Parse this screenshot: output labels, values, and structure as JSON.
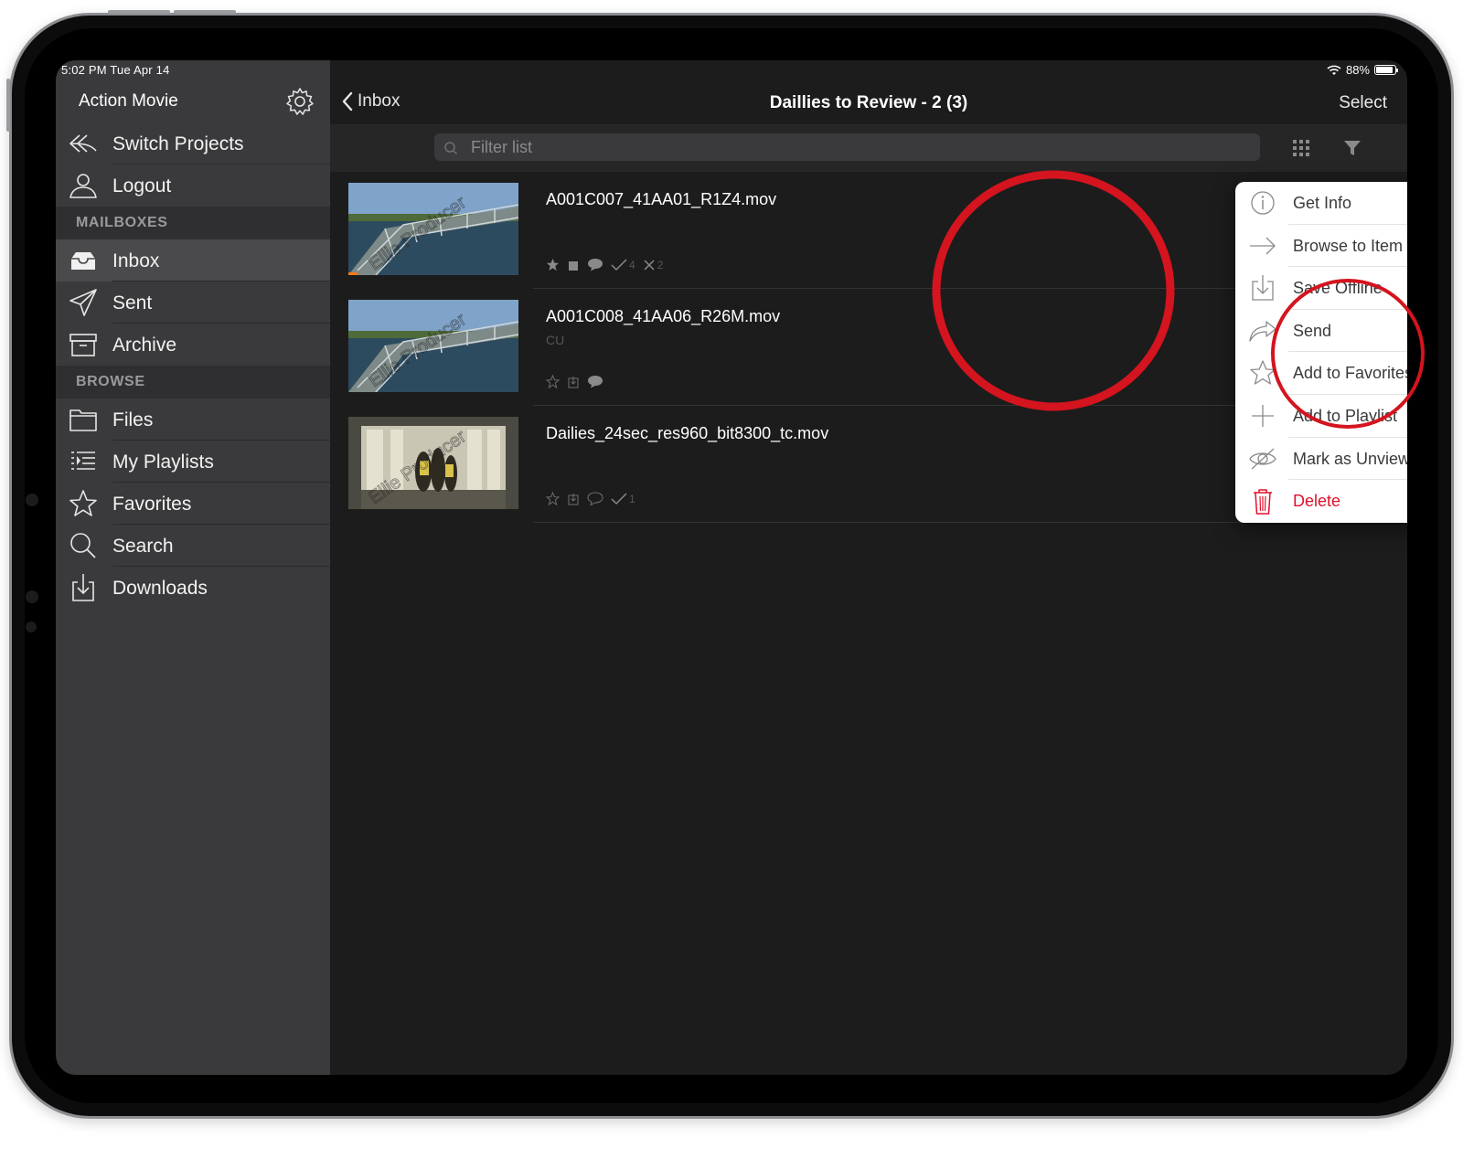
{
  "status_bar": {
    "time": "5:02 PM   Tue Apr 14",
    "battery": "88%",
    "battery_level": 0.88
  },
  "sidebar": {
    "project_title": "Action Movie",
    "items_top": [
      {
        "label": "Switch Projects",
        "icon": "switch-arrow-icon"
      },
      {
        "label": "Logout",
        "icon": "person-icon"
      }
    ],
    "mailboxes_header": "MAILBOXES",
    "mailboxes": [
      {
        "label": "Inbox",
        "icon": "inbox-icon",
        "active": true
      },
      {
        "label": "Sent",
        "icon": "paper-plane-icon"
      },
      {
        "label": "Archive",
        "icon": "archive-box-icon"
      }
    ],
    "browse_header": "BROWSE",
    "browse": [
      {
        "label": "Files",
        "icon": "folder-icon"
      },
      {
        "label": "My Playlists",
        "icon": "playlist-icon"
      },
      {
        "label": "Favorites",
        "icon": "star-icon"
      },
      {
        "label": "Search",
        "icon": "search-icon"
      },
      {
        "label": "Downloads",
        "icon": "download-icon"
      }
    ]
  },
  "navbar": {
    "back_label": "Inbox",
    "title": "Daillies to Review - 2 (3)",
    "select_label": "Select"
  },
  "filter": {
    "placeholder": "Filter list"
  },
  "files": [
    {
      "name": "A001C007_41AA01_R1Z4.mov",
      "subtitle": "",
      "approved_count": "4",
      "rejected_count": "2",
      "watermark": "Ellie Producer"
    },
    {
      "name": "A001C008_41AA06_R26M.mov",
      "subtitle": "CU",
      "approved_count": "",
      "rejected_count": "",
      "watermark": "Ellie Producer"
    },
    {
      "name": "Dailies_24sec_res960_bit8300_tc.mov",
      "subtitle": "",
      "approved_count": "1",
      "rejected_count": "",
      "watermark": "Ellie Producer"
    }
  ],
  "context_menu": {
    "items": [
      {
        "label": "Get Info",
        "icon": "info-icon"
      },
      {
        "label": "Browse to Item",
        "icon": "arrow-right-icon"
      },
      {
        "label": "Save Offline",
        "icon": "save-offline-icon"
      },
      {
        "label": "Send",
        "icon": "share-arrow-icon"
      },
      {
        "label": "Add to Favorites",
        "icon": "star-outline-icon"
      },
      {
        "label": "Add to Playlist",
        "icon": "plus-icon"
      },
      {
        "label": "Mark as Unviewed",
        "icon": "eye-slash-icon"
      },
      {
        "label": "Delete",
        "icon": "trash-icon",
        "destructive": true
      }
    ]
  },
  "colors": {
    "accent_red": "#e0102a",
    "annotation_red": "#d4141e",
    "sidebar_bg": "#3a3a3c",
    "main_bg": "#1c1c1c"
  }
}
